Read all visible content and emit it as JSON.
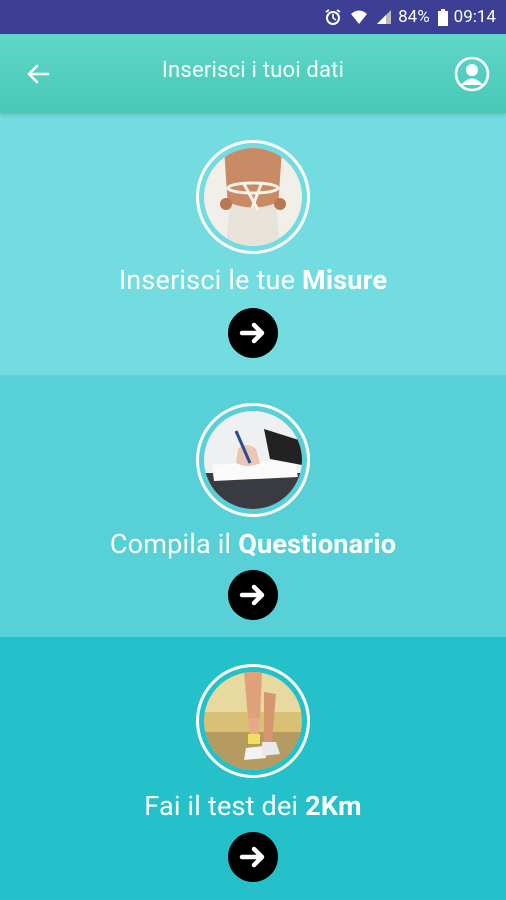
{
  "status_bar": {
    "battery": "84%",
    "time": "09:14",
    "icons": [
      "alarm-icon",
      "wifi-icon",
      "signal-icon",
      "battery-icon"
    ]
  },
  "app_bar": {
    "title": "Inserisci i tuoi dati",
    "back_icon": "arrow-left-icon",
    "profile_icon": "user-circle-icon"
  },
  "sections": [
    {
      "label_prefix": "Inserisci le tue ",
      "label_bold": "Misure",
      "image": "waist-measure-photo",
      "background": "#72dce0"
    },
    {
      "label_prefix": "Compila il ",
      "label_bold": "Questionario",
      "image": "writing-hand-photo",
      "background": "#58d0d8"
    },
    {
      "label_prefix": "Fai il test dei ",
      "label_bold": "2Km",
      "image": "runner-legs-photo",
      "background": "#25c1cb"
    }
  ],
  "colors": {
    "status_bar": "#3c3f93",
    "app_bar": "#49c8b6",
    "arrow_button": "#000000",
    "text": "#ffffff"
  }
}
